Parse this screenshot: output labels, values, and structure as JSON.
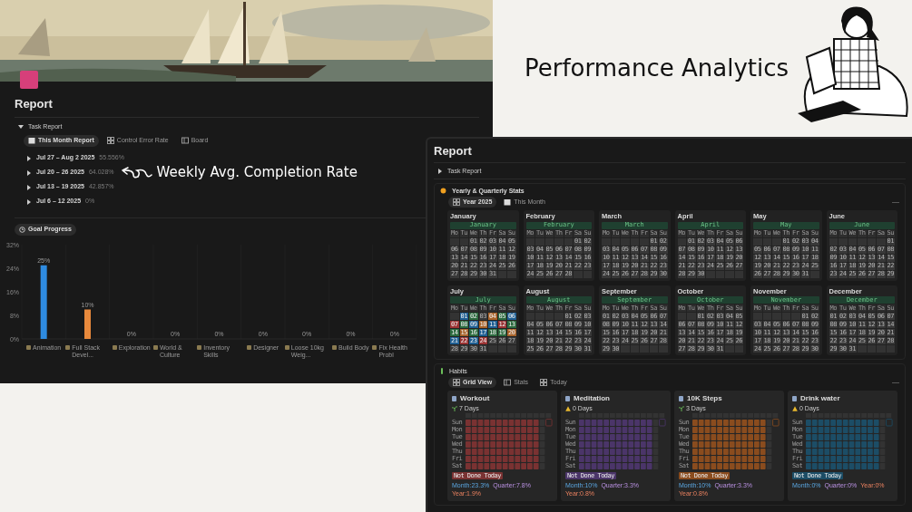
{
  "header": {
    "title": "Performance Analytics"
  },
  "left_page": {
    "title": "Report",
    "section": {
      "label": "Task Report",
      "expanded": true
    },
    "tabs": [
      {
        "label": "This Month Report",
        "selected": true,
        "kind": "calendar"
      },
      {
        "label": "Control Error Rate",
        "selected": false,
        "kind": "grid"
      },
      {
        "label": "Board",
        "selected": false,
        "kind": "board"
      }
    ],
    "weeks": [
      {
        "range": "Jul 27 – Aug 2 2025",
        "rate": "55.556%"
      },
      {
        "range": "Jul 20 – 26 2025",
        "rate": "64.028%"
      },
      {
        "range": "Jul 13 – 19 2025",
        "rate": "42.857%"
      },
      {
        "range": "Jul 6 – 12 2025",
        "rate": "0%"
      }
    ],
    "annotation": "Weekly Avg. Completion Rate",
    "goal_button": "Goal Progress",
    "chart_data": {
      "type": "bar",
      "categories": [
        "Animation",
        "Full Stack Devel...",
        "Exploration",
        "World & Culture",
        "Inventory Skills",
        "Designer",
        "Loose 10kg Weig...",
        "Build Body",
        "Fix Health Probl"
      ],
      "series": [
        {
          "color": "#2e8be0",
          "values": [
            25,
            null,
            0,
            0,
            0,
            0,
            0,
            0,
            0
          ]
        },
        {
          "color": "#e8893c",
          "values": [
            null,
            10,
            null,
            null,
            null,
            null,
            null,
            null,
            null
          ]
        }
      ],
      "ylim": [
        0,
        32
      ],
      "yticks": [
        {
          "value": 0,
          "label": "0%"
        },
        {
          "value": 8,
          "label": "8%"
        },
        {
          "value": 16,
          "label": "16%"
        },
        {
          "value": 24,
          "label": "24%"
        },
        {
          "value": 32,
          "label": "32%"
        }
      ],
      "value_labels": [
        "25%",
        "10%",
        "0%",
        "0%",
        "0%",
        "0%",
        "0%",
        "0%",
        "0%"
      ]
    }
  },
  "right_page": {
    "title": "Report",
    "section": {
      "label": "Task Report",
      "expanded": false
    },
    "yearly": {
      "title": "Yearly & Quarterly Stats",
      "tabs": [
        {
          "label": "Year 2025",
          "selected": true
        },
        {
          "label": "This Month",
          "selected": false
        }
      ],
      "months": [
        {
          "name": "January",
          "header": "January",
          "weekdays": [
            "Mo",
            "Tu",
            "We",
            "Th",
            "Fr",
            "Sa",
            "Su"
          ],
          "weeks": [
            [
              {
                "kind": "blank"
              },
              {
                "kind": "blank"
              },
              "01",
              "02",
              "03",
              "04",
              "05"
            ],
            [
              "06",
              "07",
              "08",
              "09",
              "10",
              "11",
              "12"
            ],
            [
              "13",
              "14",
              "15",
              "16",
              "17",
              "18",
              "19"
            ],
            [
              "20",
              "21",
              "22",
              "23",
              "24",
              "25",
              "26"
            ],
            [
              "27",
              "28",
              "29",
              "30",
              "31",
              {
                "kind": "blank"
              },
              {
                "kind": "blank"
              }
            ]
          ]
        },
        {
          "name": "February",
          "header": "February",
          "weekdays": [
            "Mo",
            "Tu",
            "We",
            "Th",
            "Fr",
            "Sa",
            "Su"
          ],
          "weeks": [
            [
              {
                "kind": "blank"
              },
              {
                "kind": "blank"
              },
              {
                "kind": "blank"
              },
              {
                "kind": "blank"
              },
              {
                "kind": "blank"
              },
              "01",
              "02"
            ],
            [
              "03",
              "04",
              "05",
              "06",
              "07",
              "08",
              "09"
            ],
            [
              "10",
              "11",
              "12",
              "13",
              "14",
              "15",
              "16"
            ],
            [
              "17",
              "18",
              "19",
              "20",
              "21",
              "22",
              "23"
            ],
            [
              "24",
              "25",
              "26",
              "27",
              "28",
              {
                "kind": "blank"
              },
              {
                "kind": "blank"
              }
            ]
          ]
        },
        {
          "name": "March",
          "header": "March",
          "weekdays": [
            "Mo",
            "Tu",
            "We",
            "Th",
            "Fr",
            "Sa",
            "Su"
          ],
          "weeks": [
            [
              {
                "kind": "blank"
              },
              {
                "kind": "blank"
              },
              {
                "kind": "blank"
              },
              {
                "kind": "blank"
              },
              {
                "kind": "blank"
              },
              "01",
              "02"
            ],
            [
              "03",
              "04",
              "05",
              "06",
              "07",
              "08",
              "09"
            ],
            [
              "10",
              "11",
              "12",
              "13",
              "14",
              "15",
              "16"
            ],
            [
              "17",
              "18",
              "19",
              "20",
              "21",
              "22",
              "23"
            ],
            [
              "24",
              "25",
              "26",
              "27",
              "28",
              "29",
              "30"
            ]
          ]
        },
        {
          "name": "April",
          "header": "April",
          "weekdays": [
            "Mo",
            "Tu",
            "We",
            "Th",
            "Fr",
            "Sa",
            "Su"
          ],
          "weeks": [
            [
              {
                "kind": "blank"
              },
              "01",
              "02",
              "03",
              "04",
              "05",
              "06"
            ],
            [
              "07",
              "08",
              "09",
              "10",
              "11",
              "12",
              "13"
            ],
            [
              "14",
              "15",
              "16",
              "17",
              "18",
              "19",
              "20"
            ],
            [
              "21",
              "22",
              "23",
              "24",
              "25",
              "26",
              "27"
            ],
            [
              "28",
              "29",
              "30",
              {
                "kind": "blank"
              },
              {
                "kind": "blank"
              },
              {
                "kind": "blank"
              },
              {
                "kind": "blank"
              }
            ]
          ]
        },
        {
          "name": "May",
          "header": "May",
          "weekdays": [
            "Mo",
            "Tu",
            "We",
            "Th",
            "Fr",
            "Sa",
            "Su"
          ],
          "weeks": [
            [
              {
                "kind": "blank"
              },
              {
                "kind": "blank"
              },
              {
                "kind": "blank"
              },
              "01",
              "02",
              "03",
              "04"
            ],
            [
              "05",
              "06",
              "07",
              "08",
              "09",
              "10",
              "11"
            ],
            [
              "12",
              "13",
              "14",
              "15",
              "16",
              "17",
              "18"
            ],
            [
              "19",
              "20",
              "21",
              "22",
              "23",
              "24",
              "25"
            ],
            [
              "26",
              "27",
              "28",
              "29",
              "30",
              "31",
              {
                "kind": "blank"
              }
            ]
          ]
        },
        {
          "name": "June",
          "header": "June",
          "weekdays": [
            "Mo",
            "Tu",
            "We",
            "Th",
            "Fr",
            "Sa",
            "Su"
          ],
          "weeks": [
            [
              {
                "kind": "blank"
              },
              {
                "kind": "blank"
              },
              {
                "kind": "blank"
              },
              {
                "kind": "blank"
              },
              {
                "kind": "blank"
              },
              {
                "kind": "blank"
              },
              "01"
            ],
            [
              "02",
              "03",
              "04",
              "05",
              "06",
              "07",
              "08"
            ],
            [
              "09",
              "10",
              "11",
              "12",
              "13",
              "14",
              "15"
            ],
            [
              "16",
              "17",
              "18",
              "19",
              "20",
              "21",
              "22"
            ],
            [
              "23",
              "24",
              "25",
              "26",
              "27",
              "28",
              "29"
            ]
          ]
        },
        {
          "name": "July",
          "header": "July",
          "weekdays": [
            "Mo",
            "Tu",
            "We",
            "Th",
            "Fr",
            "Sa",
            "Su"
          ],
          "weeks": [
            [
              {
                "kind": "blank"
              },
              {
                "text": "01",
                "color": "#1f5f93"
              },
              {
                "text": "02",
                "color": "#2c6b3f"
              },
              "03",
              {
                "text": "04",
                "color": "#a8632a"
              },
              {
                "text": "05",
                "color": "#2c6b3f"
              },
              {
                "text": "06",
                "color": "#1f5f93"
              }
            ],
            [
              {
                "text": "07",
                "color": "#9c3434"
              },
              {
                "text": "08",
                "color": "#2c6b3f"
              },
              {
                "text": "09",
                "color": "#1f5f93"
              },
              {
                "text": "10",
                "color": "#a8632a"
              },
              {
                "text": "11",
                "color": "#1f5f93"
              },
              {
                "text": "12",
                "color": "#9c3434"
              },
              {
                "text": "13",
                "color": "#2c6b3f"
              }
            ],
            [
              {
                "text": "14",
                "color": "#2c6b3f"
              },
              {
                "text": "15",
                "color": "#a8632a"
              },
              {
                "text": "16",
                "color": "#2c6b3f"
              },
              {
                "text": "17",
                "color": "#1f5f93"
              },
              {
                "text": "18",
                "color": "#2c6b3f"
              },
              {
                "text": "19",
                "color": "#2c6b3f"
              },
              {
                "text": "20",
                "color": "#a8632a"
              }
            ],
            [
              {
                "text": "21",
                "color": "#1f5f93"
              },
              {
                "text": "22",
                "color": "#9c3434"
              },
              {
                "text": "23",
                "color": "#1f5f93"
              },
              {
                "text": "24",
                "color": "#9c3434"
              },
              "25",
              "26",
              "27"
            ],
            [
              "28",
              "29",
              "30",
              "31",
              {
                "kind": "blank"
              },
              {
                "kind": "blank"
              },
              {
                "kind": "blank"
              }
            ]
          ]
        },
        {
          "name": "August",
          "header": "August",
          "weekdays": [
            "Mo",
            "Tu",
            "We",
            "Th",
            "Fr",
            "Sa",
            "Su"
          ],
          "weeks": [
            [
              {
                "kind": "blank"
              },
              {
                "kind": "blank"
              },
              {
                "kind": "blank"
              },
              {
                "kind": "blank"
              },
              "01",
              "02",
              "03"
            ],
            [
              "04",
              "05",
              "06",
              "07",
              "08",
              "09",
              "10"
            ],
            [
              "11",
              "12",
              "13",
              "14",
              "15",
              "16",
              "17"
            ],
            [
              "18",
              "19",
              "20",
              "21",
              "22",
              "23",
              "24"
            ],
            [
              "25",
              "26",
              "27",
              "28",
              "29",
              "30",
              "31"
            ]
          ]
        },
        {
          "name": "September",
          "header": "September",
          "weekdays": [
            "Mo",
            "Tu",
            "We",
            "Th",
            "Fr",
            "Sa",
            "Su"
          ],
          "weeks": [
            [
              "01",
              "02",
              "03",
              "04",
              "05",
              "06",
              "07"
            ],
            [
              "08",
              "09",
              "10",
              "11",
              "12",
              "13",
              "14"
            ],
            [
              "15",
              "16",
              "17",
              "18",
              "19",
              "20",
              "21"
            ],
            [
              "22",
              "23",
              "24",
              "25",
              "26",
              "27",
              "28"
            ],
            [
              "29",
              "30",
              {
                "kind": "blank"
              },
              {
                "kind": "blank"
              },
              {
                "kind": "blank"
              },
              {
                "kind": "blank"
              },
              {
                "kind": "blank"
              }
            ]
          ]
        },
        {
          "name": "October",
          "header": "October",
          "weekdays": [
            "Mo",
            "Tu",
            "We",
            "Th",
            "Fr",
            "Sa",
            "Su"
          ],
          "weeks": [
            [
              {
                "kind": "blank"
              },
              {
                "kind": "blank"
              },
              "01",
              "02",
              "03",
              "04",
              "05"
            ],
            [
              "06",
              "07",
              "08",
              "09",
              "10",
              "11",
              "12"
            ],
            [
              "13",
              "14",
              "15",
              "16",
              "17",
              "18",
              "19"
            ],
            [
              "20",
              "21",
              "22",
              "23",
              "24",
              "25",
              "26"
            ],
            [
              "27",
              "28",
              "29",
              "30",
              "31",
              {
                "kind": "blank"
              },
              {
                "kind": "blank"
              }
            ]
          ]
        },
        {
          "name": "November",
          "header": "November",
          "weekdays": [
            "Mo",
            "Tu",
            "We",
            "Th",
            "Fr",
            "Sa",
            "Su"
          ],
          "weeks": [
            [
              {
                "kind": "blank"
              },
              {
                "kind": "blank"
              },
              {
                "kind": "blank"
              },
              {
                "kind": "blank"
              },
              {
                "kind": "blank"
              },
              "01",
              "02"
            ],
            [
              "03",
              "04",
              "05",
              "06",
              "07",
              "08",
              "09"
            ],
            [
              "10",
              "11",
              "12",
              "13",
              "14",
              "15",
              "16"
            ],
            [
              "17",
              "18",
              "19",
              "20",
              "21",
              "22",
              "23"
            ],
            [
              "24",
              "25",
              "26",
              "27",
              "28",
              "29",
              "30"
            ]
          ]
        },
        {
          "name": "December",
          "header": "December",
          "weekdays": [
            "Mo",
            "Tu",
            "We",
            "Th",
            "Fr",
            "Sa",
            "Su"
          ],
          "weeks": [
            [
              "01",
              "02",
              "03",
              "04",
              "05",
              "06",
              "07"
            ],
            [
              "08",
              "09",
              "10",
              "11",
              "12",
              "13",
              "14"
            ],
            [
              "15",
              "16",
              "17",
              "18",
              "19",
              "20",
              "21"
            ],
            [
              "22",
              "23",
              "24",
              "25",
              "26",
              "27",
              "28"
            ],
            [
              "29",
              "30",
              "31",
              {
                "kind": "blank"
              },
              {
                "kind": "blank"
              },
              {
                "kind": "blank"
              },
              {
                "kind": "blank"
              }
            ]
          ]
        }
      ]
    },
    "habits": {
      "title": "Habits",
      "tabs": [
        {
          "label": "Grid View",
          "selected": true
        },
        {
          "label": "Stats",
          "selected": false
        },
        {
          "label": "Today",
          "selected": false
        }
      ],
      "cards": [
        {
          "name": "Workout",
          "streak": {
            "kind": "sprout",
            "text": "7 Days"
          },
          "color": "#7a3232",
          "weekdays": [
            "Sun",
            "Mon",
            "Tue",
            "Wed",
            "Thu",
            "Fri",
            "Sat"
          ],
          "status": "Not Done Today",
          "month": "Month:23.3%",
          "quarter": "Quarter:7.8%",
          "year": "Year:1.9%"
        },
        {
          "name": "Meditation",
          "streak": {
            "kind": "warning",
            "text": "0 Days"
          },
          "color": "#4b3569",
          "weekdays": [
            "Sun",
            "Mon",
            "Tue",
            "Wed",
            "Thu",
            "Fri",
            "Sat"
          ],
          "status": "Not Done Today",
          "month": "Month:10%",
          "quarter": "Quarter:3.3%",
          "year": "Year:0.8%"
        },
        {
          "name": "10K Steps",
          "streak": {
            "kind": "sprout",
            "text": "3 Days"
          },
          "color": "#8a4c1e",
          "weekdays": [
            "Sun",
            "Mon",
            "Tue",
            "Wed",
            "Thu",
            "Fri",
            "Sat"
          ],
          "status": "Not Done Today",
          "month": "Month:10%",
          "quarter": "Quarter:3.3%",
          "year": "Year:0.8%"
        },
        {
          "name": "Drink water",
          "streak": {
            "kind": "warning",
            "text": "0 Days"
          },
          "color": "#1c4d66",
          "weekdays": [
            "Sun",
            "Mon",
            "Tue",
            "Wed",
            "Thu",
            "Fri",
            "Sat"
          ],
          "status": "Not Done Today",
          "month": "Month:0%",
          "quarter": "Quarter:0%",
          "year": "Year:0%"
        }
      ]
    }
  }
}
